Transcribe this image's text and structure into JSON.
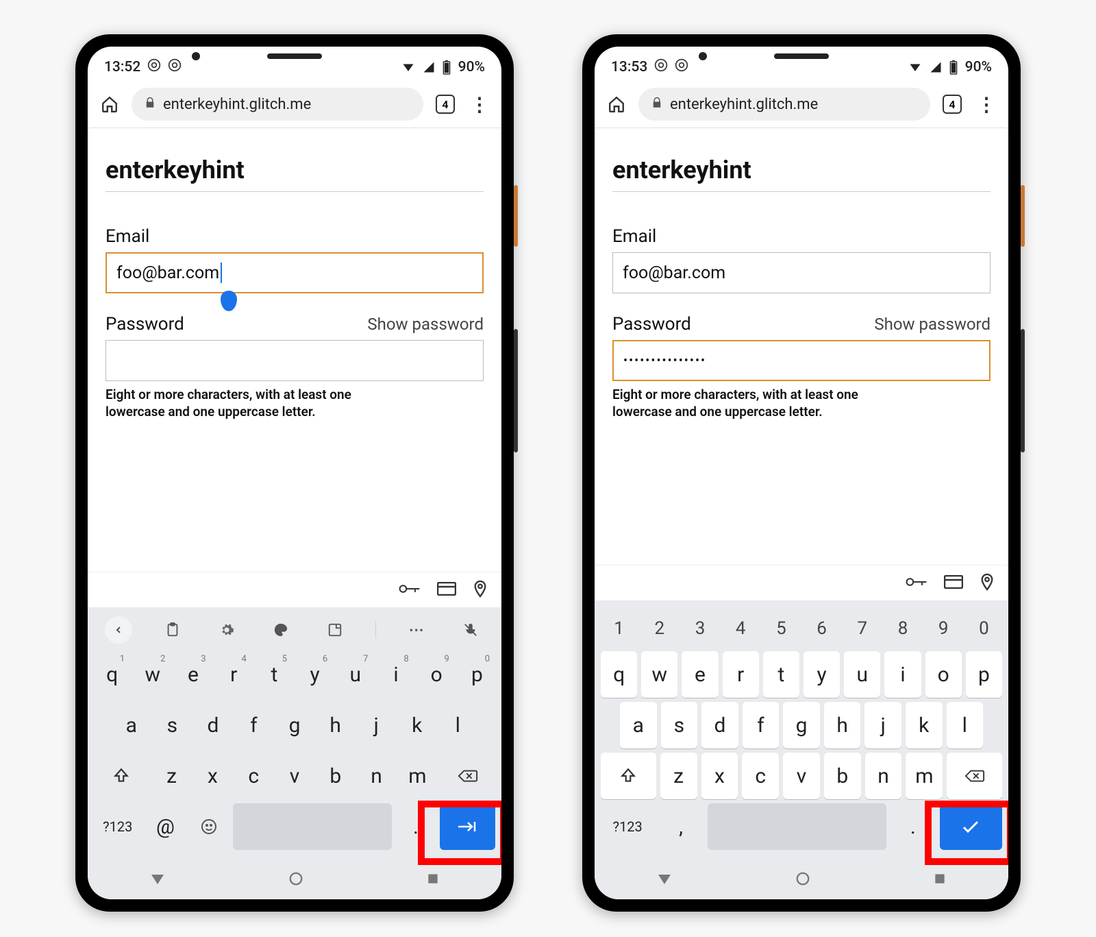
{
  "phones": [
    {
      "status": {
        "time": "13:52",
        "battery": "90%"
      },
      "urlbar": {
        "url": "enterkeyhint.glitch.me",
        "tab_count": "4"
      },
      "page": {
        "title": "enterkeyhint",
        "email_label": "Email",
        "email_value": "foo@bar.com",
        "email_focused": true,
        "password_label": "Password",
        "show_password": "Show password",
        "password_value": "",
        "password_focused": false,
        "hint": "Eight or more characters, with at least one lowercase and one uppercase letter."
      },
      "keyboard": {
        "has_toolbar": true,
        "has_number_row": false,
        "row1": [
          "q",
          "w",
          "e",
          "r",
          "t",
          "y",
          "u",
          "i",
          "o",
          "p"
        ],
        "row1_super": [
          "1",
          "2",
          "3",
          "4",
          "5",
          "6",
          "7",
          "8",
          "9",
          "0"
        ],
        "row2": [
          "a",
          "s",
          "d",
          "f",
          "g",
          "h",
          "j",
          "k",
          "l"
        ],
        "row3": [
          "z",
          "x",
          "c",
          "v",
          "b",
          "n",
          "m"
        ],
        "sym_label": "?123",
        "bottom_extra1": "@",
        "bottom_extra2": "emoji",
        "period": ".",
        "enter_icon": "next"
      }
    },
    {
      "status": {
        "time": "13:53",
        "battery": "90%"
      },
      "urlbar": {
        "url": "enterkeyhint.glitch.me",
        "tab_count": "4"
      },
      "page": {
        "title": "enterkeyhint",
        "email_label": "Email",
        "email_value": "foo@bar.com",
        "email_focused": false,
        "password_label": "Password",
        "show_password": "Show password",
        "password_value": "•••••••••••••••",
        "password_focused": true,
        "hint": "Eight or more characters, with at least one lowercase and one uppercase letter."
      },
      "keyboard": {
        "has_toolbar": false,
        "has_number_row": true,
        "number_row": [
          "1",
          "2",
          "3",
          "4",
          "5",
          "6",
          "7",
          "8",
          "9",
          "0"
        ],
        "row1": [
          "q",
          "w",
          "e",
          "r",
          "t",
          "y",
          "u",
          "i",
          "o",
          "p"
        ],
        "row1_super": [],
        "row2": [
          "a",
          "s",
          "d",
          "f",
          "g",
          "h",
          "j",
          "k",
          "l"
        ],
        "row3": [
          "z",
          "x",
          "c",
          "v",
          "b",
          "n",
          "m"
        ],
        "sym_label": "?123",
        "bottom_extra1": ",",
        "bottom_extra2": "",
        "period": ".",
        "enter_icon": "done"
      }
    }
  ]
}
